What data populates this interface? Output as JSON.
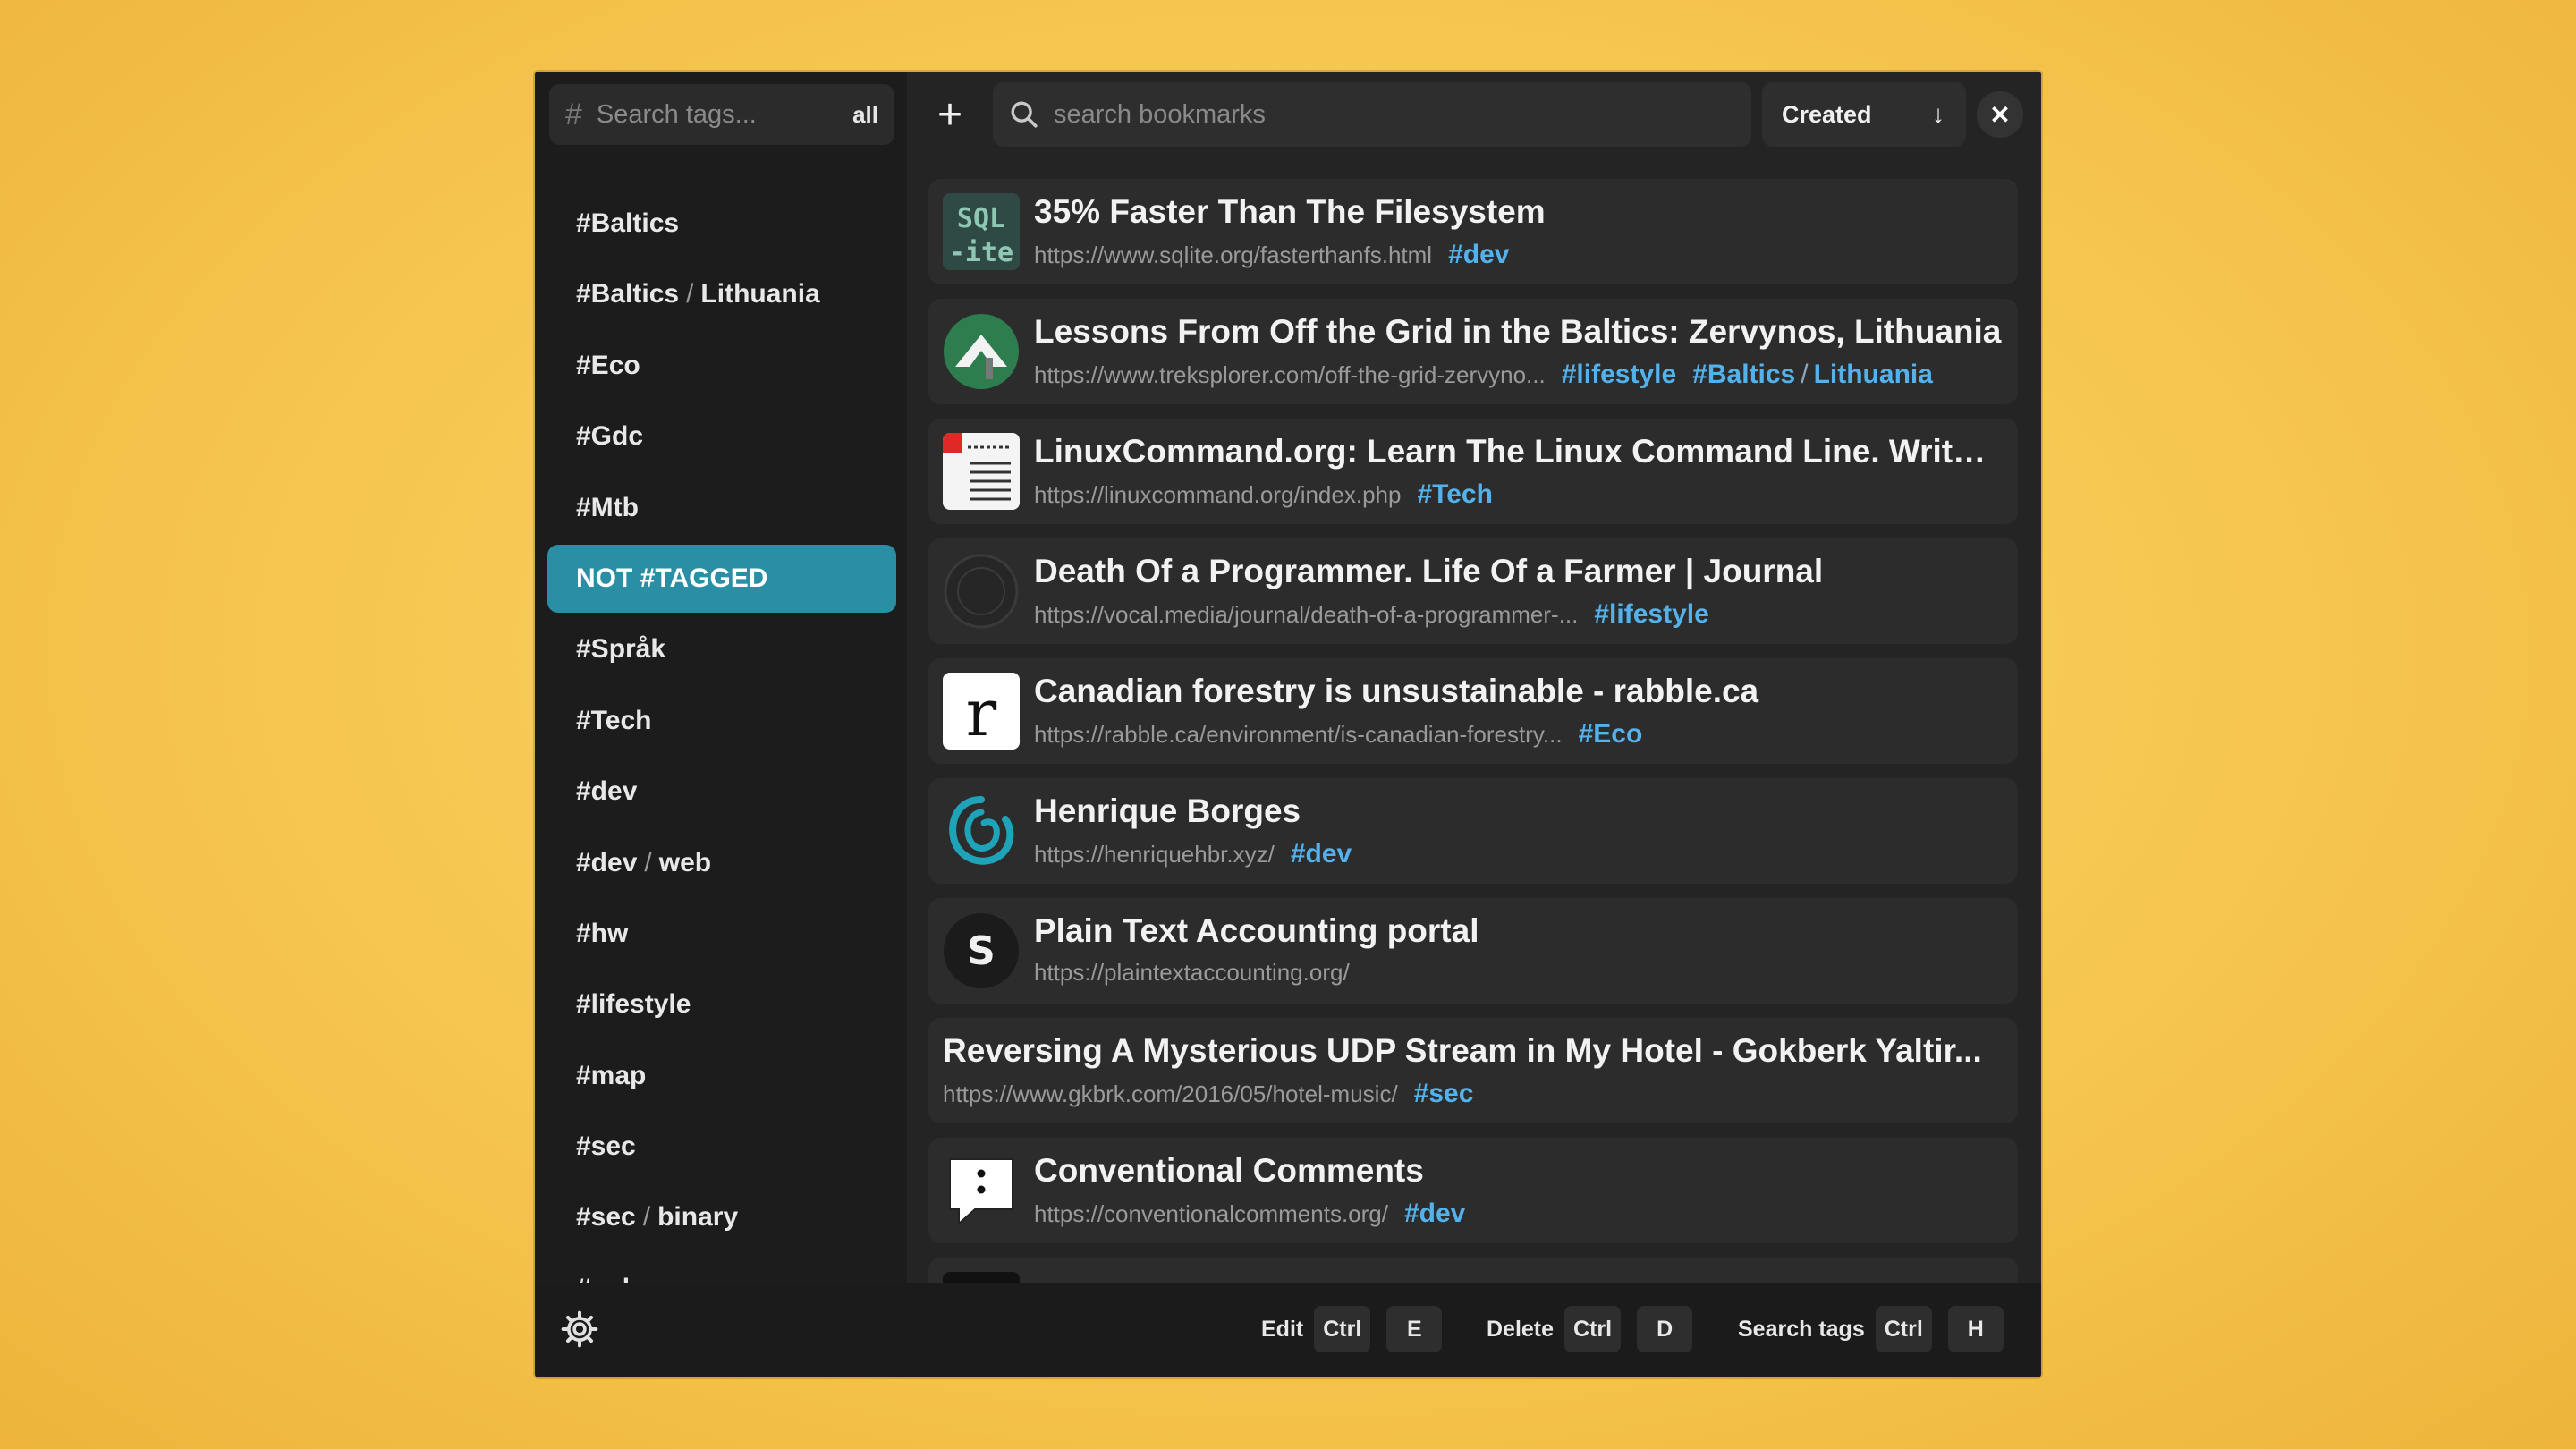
{
  "sidebar": {
    "search_placeholder": "Search tags...",
    "all_label": "all",
    "tags": [
      {
        "parts": [
          "#Baltics"
        ]
      },
      {
        "parts": [
          "#Baltics",
          "Lithuania"
        ]
      },
      {
        "parts": [
          "#Eco"
        ]
      },
      {
        "parts": [
          "#Gdc"
        ]
      },
      {
        "parts": [
          "#Mtb"
        ]
      },
      {
        "parts": [
          "NOT #TAGGED"
        ],
        "active": true
      },
      {
        "parts": [
          "#Språk"
        ]
      },
      {
        "parts": [
          "#Tech"
        ]
      },
      {
        "parts": [
          "#dev"
        ]
      },
      {
        "parts": [
          "#dev",
          "web"
        ]
      },
      {
        "parts": [
          "#hw"
        ]
      },
      {
        "parts": [
          "#lifestyle"
        ]
      },
      {
        "parts": [
          "#map"
        ]
      },
      {
        "parts": [
          "#sec"
        ]
      },
      {
        "parts": [
          "#sec",
          "binary"
        ]
      },
      {
        "parts": [
          "#solar"
        ]
      }
    ]
  },
  "topbar": {
    "search_placeholder": "search bookmarks",
    "sort_label": "Created"
  },
  "bookmarks": [
    {
      "title": "35% Faster Than The Filesystem",
      "url": "https://www.sqlite.org/fasterthanfs.html",
      "tags": [
        [
          "#dev"
        ]
      ],
      "icon": "sqlite-icon"
    },
    {
      "title": "Lessons From Off the Grid in the Baltics: Zervynos, Lithuania",
      "url": "https://www.treksplorer.com/off-the-grid-zervyno...",
      "tags": [
        [
          "#lifestyle"
        ],
        [
          "#Baltics",
          "Lithuania"
        ]
      ],
      "icon": "treksplorer-icon"
    },
    {
      "title": "LinuxCommand.org: Learn The Linux Command Line. Write ...",
      "url": "https://linuxcommand.org/index.php",
      "tags": [
        [
          "#Tech"
        ]
      ],
      "icon": "linuxcommand-icon"
    },
    {
      "title": "Death Of a Programmer. Life Of a Farmer | Journal",
      "url": "https://vocal.media/journal/death-of-a-programmer-...",
      "tags": [
        [
          "#lifestyle"
        ]
      ],
      "icon": "vocal-icon"
    },
    {
      "title": "Canadian forestry is unsustainable - rabble.ca",
      "url": "https://rabble.ca/environment/is-canadian-forestry...",
      "tags": [
        [
          "#Eco"
        ]
      ],
      "icon": "rabble-icon"
    },
    {
      "title": "Henrique Borges",
      "url": "https://henriquehbr.xyz/",
      "tags": [
        [
          "#dev"
        ]
      ],
      "icon": "henrique-icon"
    },
    {
      "title": "Plain Text Accounting portal",
      "url": "https://plaintextaccounting.org/",
      "tags": [],
      "icon": "plaintext-icon"
    },
    {
      "title": "Reversing A Mysterious UDP Stream in My Hotel - Gokberk Yaltir...",
      "url": "https://www.gkbrk.com/2016/05/hotel-music/",
      "tags": [
        [
          "#sec"
        ]
      ],
      "icon": null
    },
    {
      "title": "Conventional Comments",
      "url": "https://conventionalcomments.org/",
      "tags": [
        [
          "#dev"
        ]
      ],
      "icon": "comment-icon"
    }
  ],
  "bottombar": {
    "edit_label": "Edit",
    "edit_keys": [
      "Ctrl",
      "E"
    ],
    "delete_label": "Delete",
    "delete_keys": [
      "Ctrl",
      "D"
    ],
    "search_tags_label": "Search tags",
    "search_tags_keys": [
      "Ctrl",
      "H"
    ]
  },
  "colors": {
    "accent": "#2a8fa4",
    "tag": "#53b1ec",
    "background": "#f6c64e"
  }
}
